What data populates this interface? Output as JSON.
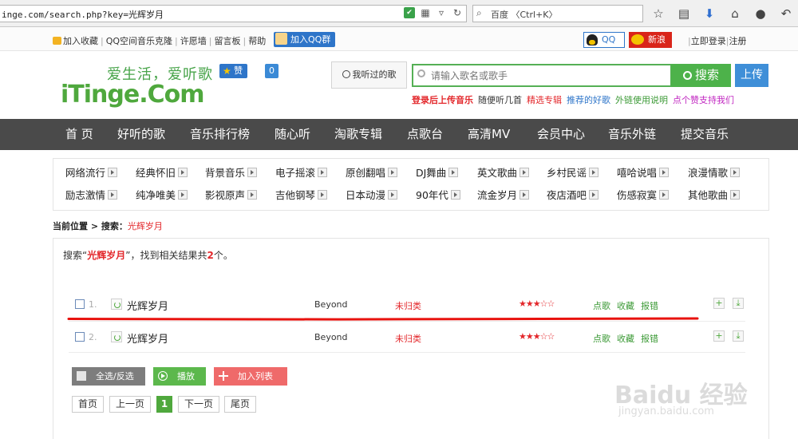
{
  "browser": {
    "url": "inge.com/search.php?key=光辉岁月",
    "search_engine_text": "百度 〈Ctrl+K〉"
  },
  "topbar": {
    "links": [
      "加入收藏",
      "QQ空间音乐克隆",
      "许愿墙",
      "留言板",
      "帮助"
    ],
    "qq_group": "加入QQ群",
    "qq_label": "QQ",
    "weibo_label": "新浪",
    "login": "立即登录",
    "register": "注册"
  },
  "header": {
    "slogan": "爱生活，爱听歌",
    "brand": "iTinge.Com",
    "zan_label": "赞",
    "zan_count": "0",
    "heard_label": "我听过的歌",
    "search_placeholder": "请输入歌名或歌手",
    "search_button": "搜索",
    "upload_button": "上传",
    "hotlinks": [
      {
        "text": "登录后上传音乐",
        "color": "#e3272b",
        "bold": true
      },
      {
        "text": "随便听几首",
        "color": "#333333"
      },
      {
        "text": "精选专辑",
        "color": "#e3272b"
      },
      {
        "text": "推荐的好歌",
        "color": "#2e75c9"
      },
      {
        "text": "外链使用说明",
        "color": "#3c9a36"
      },
      {
        "text": "点个赞支持我们",
        "color": "#c026c0"
      }
    ]
  },
  "nav": [
    "首 页",
    "好听的歌",
    "音乐排行榜",
    "随心听",
    "淘歌专辑",
    "点歌台",
    "高清MV",
    "会员中心",
    "音乐外链",
    "提交音乐"
  ],
  "categories": [
    [
      "网络流行",
      "经典怀旧",
      "背景音乐",
      "电子摇滚",
      "原创翻唱",
      "DJ舞曲",
      "英文歌曲",
      "乡村民谣",
      "嘻哈说唱",
      "浪漫情歌"
    ],
    [
      "励志激情",
      "纯净唯美",
      "影视原声",
      "吉他钢琴",
      "日本动漫",
      "90年代",
      "流金岁月",
      "夜店酒吧",
      "伤感寂寞",
      "其他歌曲"
    ]
  ],
  "breadcrumb": {
    "prefix": "当前位置 > 搜索：",
    "keyword": "光辉岁月"
  },
  "results": {
    "summary_pre": "搜索“",
    "keyword": "光辉岁月",
    "summary_mid": "”，找到相关结果共",
    "count": "2",
    "summary_post": "个。",
    "rows": [
      {
        "num": "1.",
        "title": "光辉岁月",
        "artist": "Beyond",
        "category": "未归类",
        "rating": 3,
        "stars": "★★★☆☆",
        "actions": [
          "点歌",
          "收藏",
          "报错"
        ]
      },
      {
        "num": "2.",
        "title": "光辉岁月",
        "artist": "Beyond",
        "category": "未归类",
        "rating": 3,
        "stars": "★★★☆☆",
        "actions": [
          "点歌",
          "收藏",
          "报错"
        ]
      }
    ],
    "buttons": {
      "select_all": "全选/反选",
      "play": "播放",
      "add_list": "加入列表"
    },
    "pager": [
      "首页",
      "上一页",
      "1",
      "下一页",
      "尾页"
    ]
  },
  "watermark": {
    "main": "Baidu 经验",
    "sub": "jingyan.baidu.com"
  },
  "colors": {
    "accent_green": "#4fa83d",
    "nav_bg": "#4a4a4a",
    "highlight_red": "#e3272b"
  }
}
